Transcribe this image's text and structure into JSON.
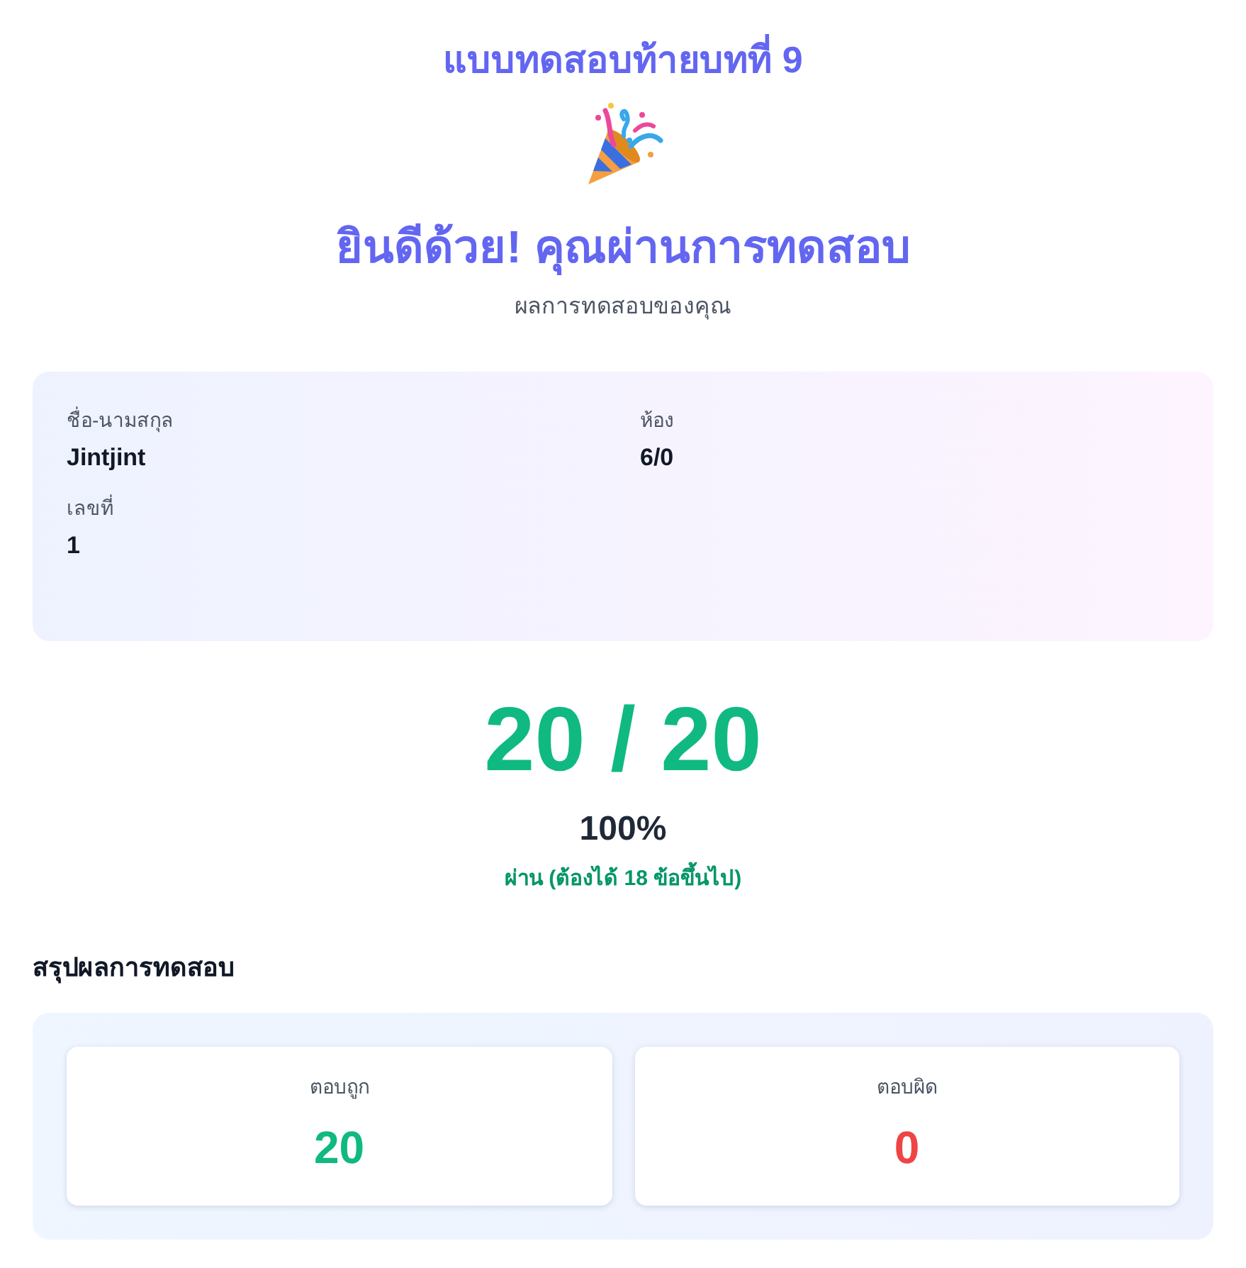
{
  "title": "แบบทดสอบท้ายบทที่ 9",
  "heading": "ยินดีด้วย! คุณผ่านการทดสอบ",
  "subtitle": "ผลการทดสอบของคุณ",
  "student_info": {
    "fields": [
      {
        "label": "ชื่อ-นามสกุล",
        "value": "Jintjint"
      },
      {
        "label": "ห้อง",
        "value": "6/0"
      },
      {
        "label": "เลขที่",
        "value": "1"
      }
    ]
  },
  "score": {
    "value": "20 / 20",
    "percent": "100%",
    "result": "ผ่าน (ต้องได้ 18 ข้อขึ้นไป)",
    "passed": true
  },
  "summary": {
    "title": "สรุปผลการทดสอบ",
    "stats": [
      {
        "label": "ตอบถูก",
        "value": "20",
        "color": "#10b981"
      },
      {
        "label": "ตอบผิด",
        "value": "0",
        "color": "#ef4444"
      }
    ]
  }
}
